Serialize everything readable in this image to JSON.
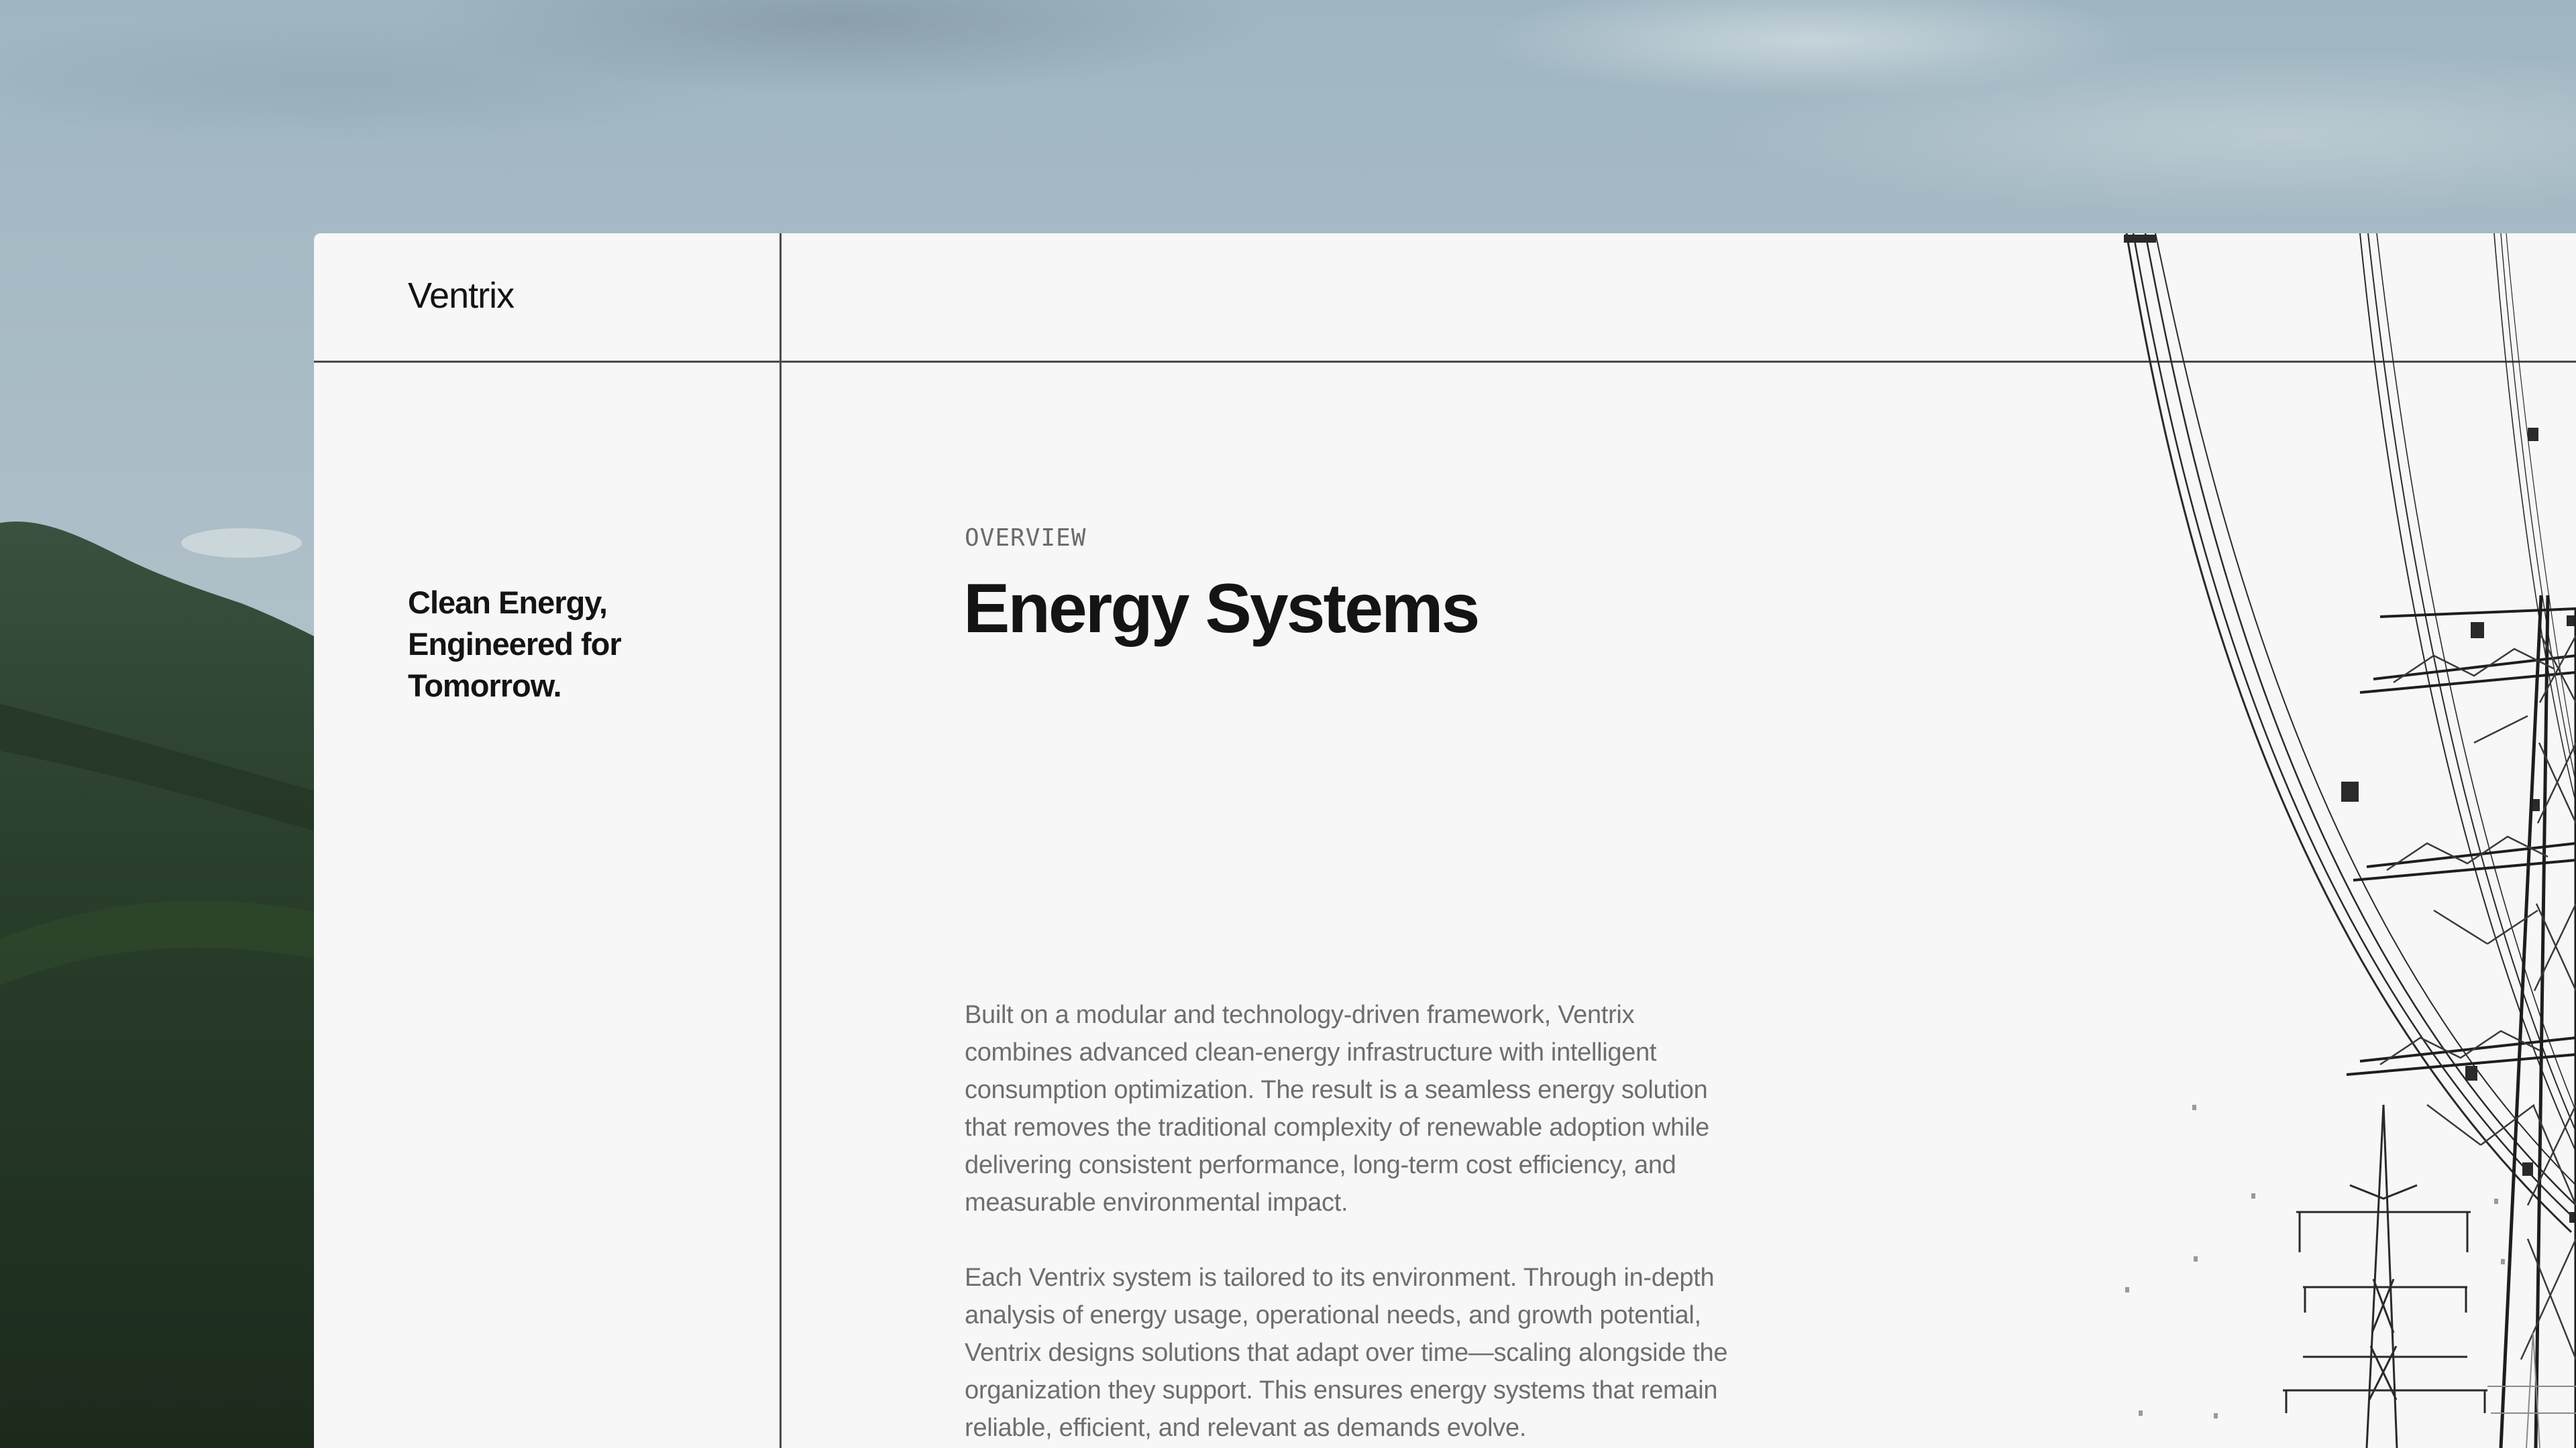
{
  "brand": {
    "name": "Ventrix"
  },
  "sidebar": {
    "tagline": "Clean Energy, Engineered for Tomorrow."
  },
  "main": {
    "eyebrow": "OVERVIEW",
    "title": "Energy Systems",
    "paragraphs": [
      "Built on a modular and technology-driven framework, Ventrix combines advanced clean-energy infrastructure with intelligent consumption optimization. The result is a seamless energy solution that removes the traditional complexity of renewable adoption while delivering consistent performance, long-term cost efficiency, and measurable environmental impact.",
      "Each Ventrix system is tailored to its environment. Through in-depth analysis of energy usage, operational needs, and growth potential, Ventrix designs solutions that adapt over time—scaling alongside the organization they support. This ensures energy systems that remain reliable, efficient, and relevant as demands evolve."
    ]
  },
  "colors": {
    "card_background": "#f7f7f7",
    "divider": "#4a4a4a",
    "heading_text": "#141414",
    "body_text": "#6e6e6e",
    "eyebrow_text": "#6b6b6b"
  }
}
